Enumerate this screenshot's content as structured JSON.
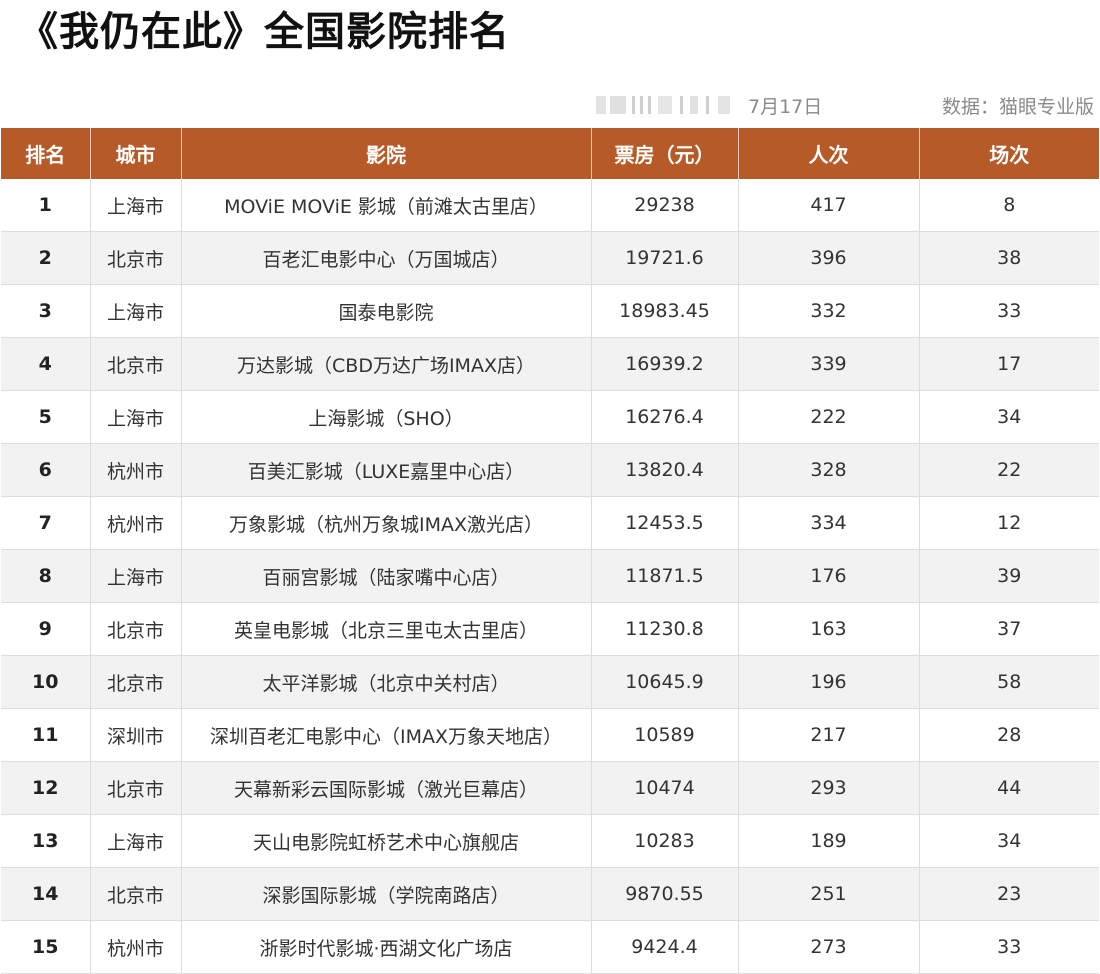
{
  "title": "《我仍在此》全国影院排名",
  "meta": {
    "date": "7月17日",
    "source": "数据：猫眼专业版"
  },
  "table": {
    "headers": [
      "排名",
      "城市",
      "影院",
      "票房（元）",
      "人次",
      "场次"
    ],
    "rows": [
      {
        "rank": "1",
        "city": "上海市",
        "cinema": "MOViE MOViE 影城（前滩太古里店）",
        "boxoffice": "29238",
        "admissions": "417",
        "shows": "8"
      },
      {
        "rank": "2",
        "city": "北京市",
        "cinema": "百老汇电影中心（万国城店）",
        "boxoffice": "19721.6",
        "admissions": "396",
        "shows": "38"
      },
      {
        "rank": "3",
        "city": "上海市",
        "cinema": "国泰电影院",
        "boxoffice": "18983.45",
        "admissions": "332",
        "shows": "33"
      },
      {
        "rank": "4",
        "city": "北京市",
        "cinema": "万达影城（CBD万达广场IMAX店）",
        "boxoffice": "16939.2",
        "admissions": "339",
        "shows": "17"
      },
      {
        "rank": "5",
        "city": "上海市",
        "cinema": "上海影城（SHO）",
        "boxoffice": "16276.4",
        "admissions": "222",
        "shows": "34"
      },
      {
        "rank": "6",
        "city": "杭州市",
        "cinema": "百美汇影城（LUXE嘉里中心店）",
        "boxoffice": "13820.4",
        "admissions": "328",
        "shows": "22"
      },
      {
        "rank": "7",
        "city": "杭州市",
        "cinema": "万象影城（杭州万象城IMAX激光店）",
        "boxoffice": "12453.5",
        "admissions": "334",
        "shows": "12"
      },
      {
        "rank": "8",
        "city": "上海市",
        "cinema": "百丽宫影城（陆家嘴中心店）",
        "boxoffice": "11871.5",
        "admissions": "176",
        "shows": "39"
      },
      {
        "rank": "9",
        "city": "北京市",
        "cinema": "英皇电影城（北京三里屯太古里店）",
        "boxoffice": "11230.8",
        "admissions": "163",
        "shows": "37"
      },
      {
        "rank": "10",
        "city": "北京市",
        "cinema": "太平洋影城（北京中关村店）",
        "boxoffice": "10645.9",
        "admissions": "196",
        "shows": "58"
      },
      {
        "rank": "11",
        "city": "深圳市",
        "cinema": "深圳百老汇电影中心（IMAX万象天地店）",
        "boxoffice": "10589",
        "admissions": "217",
        "shows": "28"
      },
      {
        "rank": "12",
        "city": "北京市",
        "cinema": "天幕新彩云国际影城（激光巨幕店）",
        "boxoffice": "10474",
        "admissions": "293",
        "shows": "44"
      },
      {
        "rank": "13",
        "city": "上海市",
        "cinema": "天山电影院虹桥艺术中心旗舰店",
        "boxoffice": "10283",
        "admissions": "189",
        "shows": "34"
      },
      {
        "rank": "14",
        "city": "北京市",
        "cinema": "深影国际影城（学院南路店）",
        "boxoffice": "9870.55",
        "admissions": "251",
        "shows": "23"
      },
      {
        "rank": "15",
        "city": "杭州市",
        "cinema": "浙影时代影城·西湖文化广场店",
        "boxoffice": "9424.4",
        "admissions": "273",
        "shows": "33"
      }
    ]
  },
  "colors": {
    "header_bg": "#b65a27",
    "header_text": "#ffffff",
    "stripe": "#f2f2f2"
  }
}
